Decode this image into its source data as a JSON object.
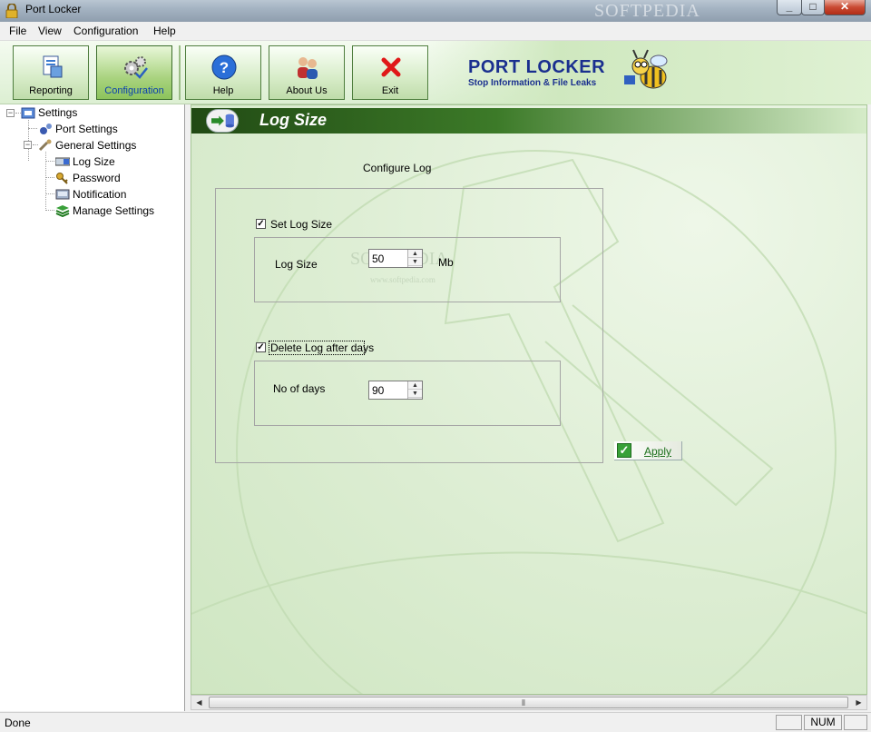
{
  "window": {
    "title": "Port Locker",
    "watermark": "SOFTPEDIA"
  },
  "menu": {
    "items": [
      "File",
      "View",
      "Configuration",
      "Help"
    ]
  },
  "toolbar": {
    "buttons": [
      {
        "label": "Reporting"
      },
      {
        "label": "Configuration"
      },
      {
        "label": "Help"
      },
      {
        "label": "About Us"
      },
      {
        "label": "Exit"
      }
    ],
    "active": "Configuration",
    "brand_title": "PORT LOCKER",
    "brand_tagline": "Stop Information & File Leaks"
  },
  "tree": {
    "root": "Settings",
    "port_settings": "Port Settings",
    "general_settings": "General Settings",
    "log_size": "Log Size",
    "password": "Password",
    "notification": "Notification",
    "manage_settings": "Manage Settings"
  },
  "panel": {
    "title": "Log Size",
    "configure_label": "Configure Log",
    "set_log_size": {
      "label": "Set Log Size",
      "checked": true
    },
    "log_size": {
      "label": "Log Size",
      "value": "50",
      "unit": "Mb"
    },
    "delete_log": {
      "label": "Delete Log after days",
      "checked": true
    },
    "days": {
      "label": "No of days",
      "value": "90"
    },
    "apply_label": "Apply",
    "watermark_text": "SOFTPEDIA",
    "watermark_url": "www.softpedia.com"
  },
  "status": {
    "text": "Done",
    "num": "NUM"
  },
  "colors": {
    "header_dark": "#214a14",
    "brand_blue": "#1a2f8f",
    "apply_green": "#1b6f1b"
  }
}
